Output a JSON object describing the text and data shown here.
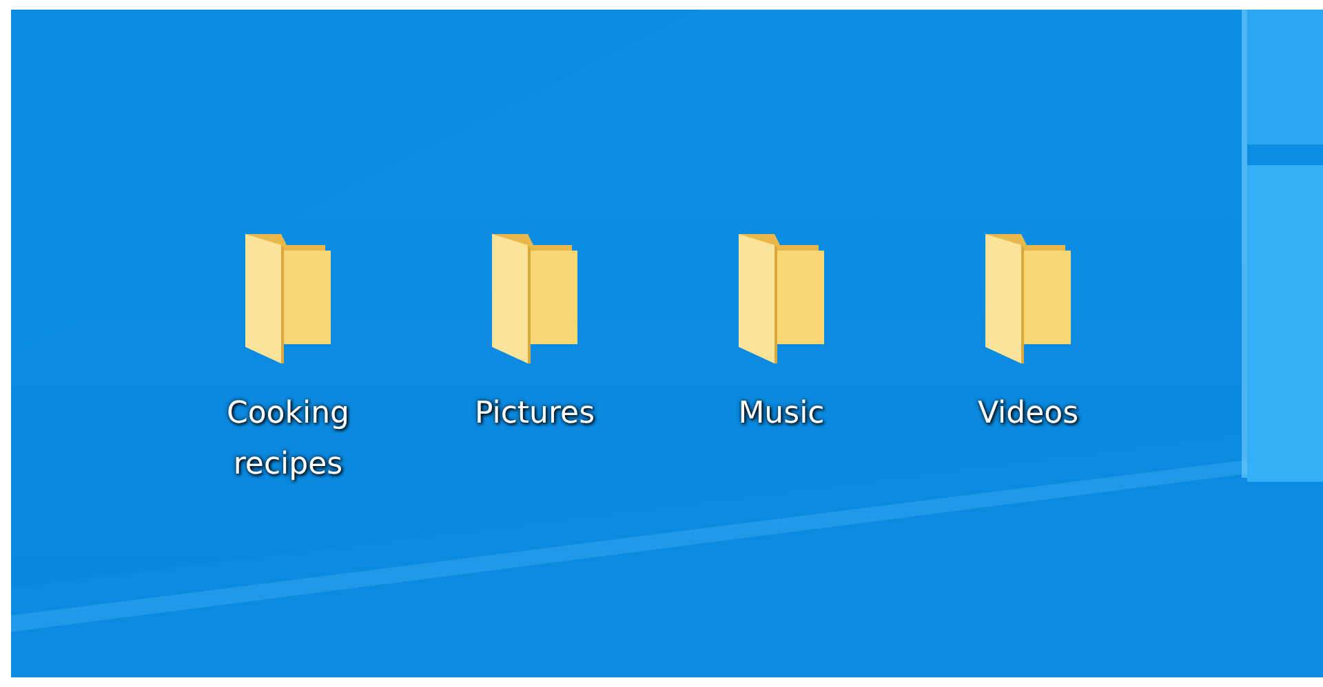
{
  "desktop": {
    "icons": [
      {
        "kind": "folder",
        "label": "Cooking recipes"
      },
      {
        "kind": "folder",
        "label": "Pictures"
      },
      {
        "kind": "folder",
        "label": "Music"
      },
      {
        "kind": "folder",
        "label": "Videos"
      }
    ]
  }
}
